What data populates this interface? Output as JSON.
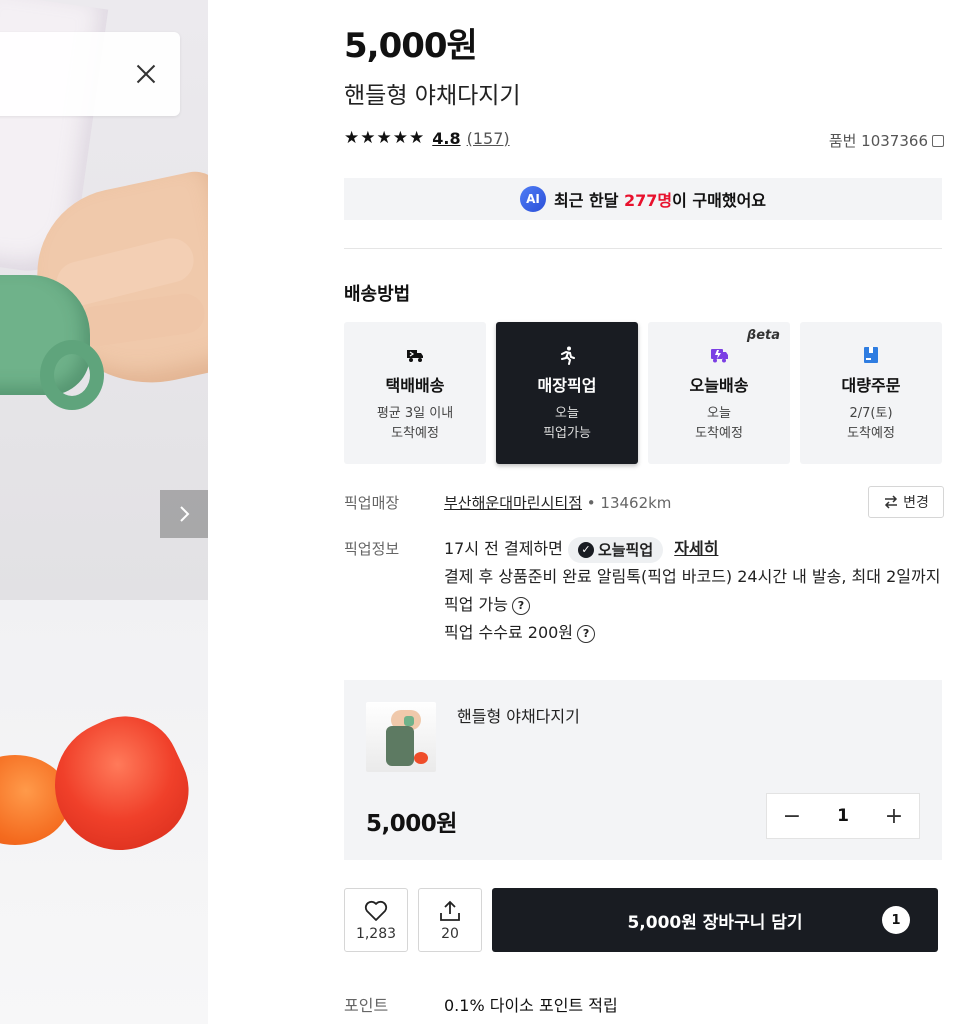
{
  "product": {
    "price": "5,000원",
    "title": "핸들형 야채다지기",
    "rating": "4.8",
    "review_count": "(157)",
    "sku": "품번 1037366",
    "stars": 5
  },
  "ai_banner": {
    "badge": "AI",
    "prefix": "최근 한달 ",
    "count": "277명",
    "suffix": "이 구매했어요"
  },
  "shipping": {
    "label": "배송방법",
    "options": [
      {
        "name": "택배배송",
        "desc1": "평균 3일 이내",
        "desc2": "도착예정",
        "icon": "truck-icon"
      },
      {
        "name": "매장픽업",
        "desc1": "오늘",
        "desc2": "픽업가능",
        "icon": "running-person-icon"
      },
      {
        "name": "오늘배송",
        "desc1": "오늘",
        "desc2": "도착예정",
        "icon": "fast-delivery-icon",
        "badge": "βeta"
      },
      {
        "name": "대량주문",
        "desc1": "2/7(토)",
        "desc2": "도착예정",
        "icon": "box-icon"
      }
    ],
    "accent_purple": "#7b3fe4",
    "accent_blue": "#2f7de1",
    "active_bg": "#191c22"
  },
  "pickup": {
    "store_label": "픽업매장",
    "store_name": "부산해운대마린시티점",
    "separator": " • ",
    "distance": "13462km",
    "change_label": "변경",
    "info_label": "픽업정보",
    "info_prefix": "17시 전 결제하면",
    "today_badge": "오늘픽업",
    "detail_link": "자세히",
    "info_line2": "결제 후 상품준비 완료 알림톡(픽업 바코드) 24시간 내 발송, 최대 2일까지 픽업 가능",
    "fee": "픽업 수수료 200원"
  },
  "cart": {
    "item_name": "핸들형 야채다지기",
    "price": "5,000원",
    "quantity": "1",
    "minus": "−",
    "plus": "+"
  },
  "actions": {
    "like_count": "1,283",
    "share_count": "20",
    "cart_button": "5,000원 장바구니 담기",
    "cart_badge": "1"
  },
  "point": {
    "label": "포인트",
    "value": "0.1% 다이소 포인트 적립"
  }
}
